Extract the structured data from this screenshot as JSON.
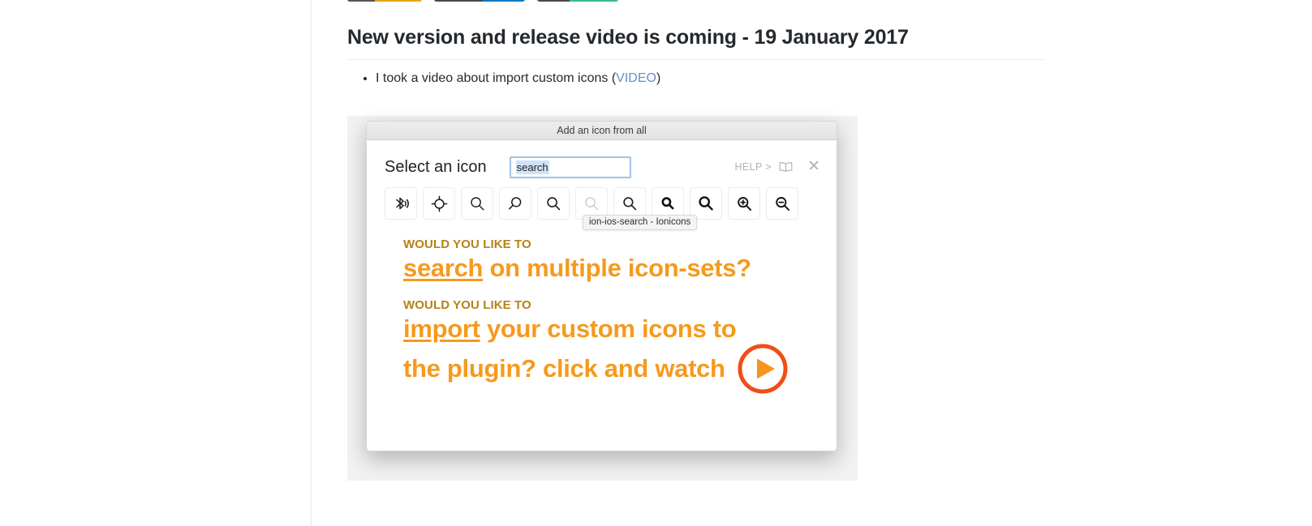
{
  "page": {
    "badges": [
      {
        "left_label": "",
        "right_label": "",
        "left_color": "#555555",
        "right_color": "#e8a317",
        "left_w": 34,
        "right_w": 58
      },
      {
        "left_label": "",
        "right_label": "",
        "left_color": "#4a4a4a",
        "right_color": "#0a7bc1",
        "left_w": 60,
        "right_w": 52
      },
      {
        "left_label": "",
        "right_label": "",
        "left_color": "#4a4a4a",
        "right_color": "#3fb98a",
        "left_w": 40,
        "right_w": 60
      }
    ],
    "heading": "New version and release video is coming - 19 January 2017",
    "bullet_prefix": "I took a video about import custom icons (",
    "bullet_link": "VIDEO",
    "bullet_suffix": ")"
  },
  "dialog": {
    "titlebar": "Add an icon from all",
    "select_label": "Select an icon",
    "search": {
      "value": "search",
      "placeholder": "search"
    },
    "help_label": "HELP >",
    "close_label": "✕",
    "tooltip": "ion-ios-search - Ionicons",
    "icons": [
      {
        "name": "bluetooth-searching-icon"
      },
      {
        "name": "crosshair-target-icon"
      },
      {
        "name": "magnify-thin-icon"
      },
      {
        "name": "magnify-left-handle-icon"
      },
      {
        "name": "magnify-medium-icon"
      },
      {
        "name": "magnify-light-gray-icon"
      },
      {
        "name": "magnify-regular-icon"
      },
      {
        "name": "magnify-bold-small-icon"
      },
      {
        "name": "magnify-bold-large-icon"
      },
      {
        "name": "magnify-zoom-in-icon"
      },
      {
        "name": "magnify-zoom-out-icon"
      }
    ]
  },
  "promo": {
    "blocks": [
      {
        "kicker": "WOULD YOU LIKE TO",
        "link_word": "search",
        "rest": " on multiple icon-sets?",
        "line2": ""
      },
      {
        "kicker": "WOULD YOU LIKE TO",
        "link_word": "import",
        "rest": " your custom icons to",
        "line2": "the plugin? click and watch"
      }
    ],
    "colors": {
      "kicker": "#b78218",
      "body": "#f59a1e",
      "play": "#f04e18"
    }
  }
}
